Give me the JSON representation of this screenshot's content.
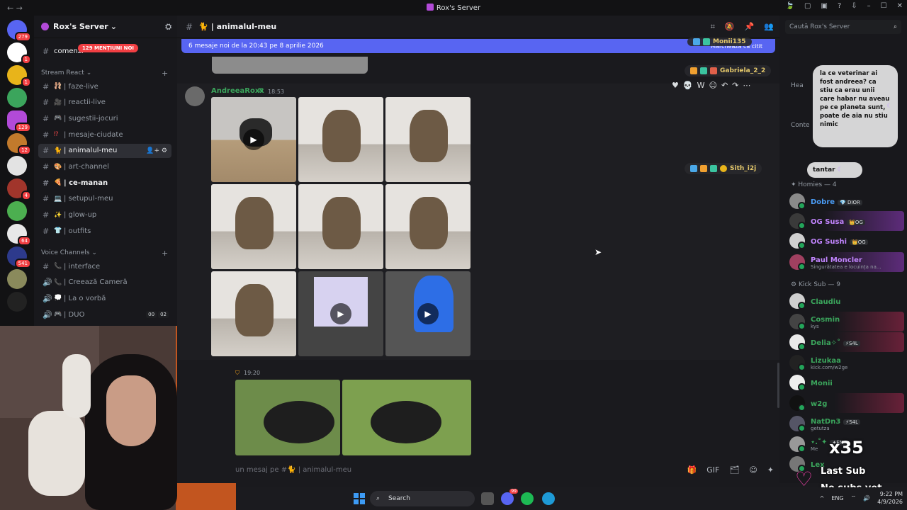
{
  "window": {
    "title": "Rox's Server",
    "nav": "← →",
    "controls": [
      "🍃",
      "▢",
      "▣",
      "?",
      "⇩",
      "–",
      "☐",
      "✕"
    ]
  },
  "servers": {
    "items": [
      {
        "name": "home",
        "color": "#5865f2",
        "badge": "279"
      },
      {
        "name": "server-w",
        "color": "#ffffff",
        "badge": "1"
      },
      {
        "name": "server-yellow",
        "color": "#e8b41a",
        "badge": "1"
      },
      {
        "name": "server-green",
        "color": "#3ba55c",
        "badge": ""
      },
      {
        "name": "server-rox",
        "color": "#b24ad8",
        "badge": "129"
      },
      {
        "name": "server-hammer",
        "color": "#c27a2c",
        "badge": "12"
      },
      {
        "name": "server-discord",
        "color": "#e3e3e3",
        "badge": ""
      },
      {
        "name": "server-red",
        "color": "#a1352b",
        "badge": "4"
      },
      {
        "name": "server-green2",
        "color": "#4caf50",
        "badge": ""
      },
      {
        "name": "server-pokemon",
        "color": "#e8e8e8",
        "badge": "64"
      },
      {
        "name": "server-star",
        "color": "#2d3a8c",
        "badge": "541"
      },
      {
        "name": "server-x",
        "color": "#8a8a5c",
        "badge": ""
      },
      {
        "name": "server-w2g",
        "color": "#222222",
        "badge": ""
      }
    ]
  },
  "server": {
    "name": "Rox's Server",
    "chevron": "⌄",
    "mentions": "129 MENȚIUNI NOI",
    "partial_channel": "comenzi"
  },
  "categories": {
    "stream_react": "Stream React",
    "voice": "Voice Channels",
    "stream_arrow": "⌄",
    "voice_arrow": "⌄"
  },
  "channels": [
    {
      "name": "| faze-live",
      "emoji": "🩰",
      "color": "#e86a7a"
    },
    {
      "name": "| reactii-live",
      "emoji": "🎥",
      "color": "#d99"
    },
    {
      "name": "| sugestii-jocuri",
      "emoji": "🎮",
      "color": "#9c7cff"
    },
    {
      "name": "| mesaje-ciudate",
      "emoji": "⁉",
      "color": "#f04747"
    },
    {
      "name": "| animalul-meu",
      "emoji": "🐈",
      "color": "#e8a05a",
      "active": true
    },
    {
      "name": "| art-channel",
      "emoji": "🎨",
      "color": "#eab"
    },
    {
      "name": "| ce-manan",
      "emoji": "🍕",
      "color": "#f0a030",
      "bold": true
    },
    {
      "name": "| setupul-meu",
      "emoji": "💻",
      "color": "#4aa8e8"
    },
    {
      "name": "| glow-up",
      "emoji": "✨",
      "color": "#f5d76e"
    },
    {
      "name": "| outfits",
      "emoji": "👕",
      "color": "#3ba55c"
    }
  ],
  "voice_channels": [
    {
      "name": "| interface",
      "emoji": "📞",
      "icon": "#"
    },
    {
      "name": "| Creează Cameră",
      "emoji": "📞",
      "icon": "🔊"
    },
    {
      "name": "| La o vorbă",
      "emoji": "💭",
      "icon": "🔊"
    },
    {
      "name": "| DUO",
      "emoji": "🎮",
      "icon": "🔊",
      "counts": [
        "00",
        "02"
      ]
    }
  ],
  "channel_header": {
    "name": "| animalul-meu",
    "emoji": "🐈",
    "hash": "#"
  },
  "new_messages": {
    "text": "6 mesaje noi de la 20:43 pe 8 aprilie 2026",
    "mark": "Marchează ca citit"
  },
  "message": {
    "author": "AndreeaRoxx",
    "time": "18:53",
    "author_icon": "⊠"
  },
  "message2": {
    "time": "19:20"
  },
  "hover_actions": [
    "♥",
    "💀",
    "W",
    "☺",
    "↶",
    "↷",
    "⋯"
  ],
  "composer": {
    "placeholder": "un mesaj pe #🐈 | animalul-meu",
    "icons": [
      "🎁",
      "GIF",
      "🗂",
      "☺",
      "✦"
    ]
  },
  "floaters": [
    {
      "name": "Gabriela_2_2"
    },
    {
      "name": "Sith_i2j"
    },
    {
      "name": "Monii135"
    }
  ],
  "search": {
    "placeholder": "Caută Rox's Server"
  },
  "chat_bubble": {
    "text": "la ce veterinar ai fost andreea? ca stiu ca erau unii care habar nu aveau pe ce planeta sunt, poate de aia nu stiu nimic",
    "small": "tantar"
  },
  "member_groups": {
    "homies": "Homies — 4",
    "kick_sub": "Kick Sub — 9",
    "content": "Conte",
    "head": "Hea"
  },
  "members": [
    {
      "name": "Dobre",
      "tag": "💎 DIOR",
      "sub": "",
      "color": "#4a9cf5"
    },
    {
      "name": "OG Susa",
      "tag": "👑OG",
      "sub": "",
      "color": "#c084fc"
    },
    {
      "name": "OG Sushi",
      "tag": "👑OG",
      "sub": "",
      "color": "#c084fc"
    },
    {
      "name": "Paul Moncler",
      "tag": "",
      "sub": "Singurătatea e locuința na...",
      "color": "#c084fc"
    },
    {
      "name": "Claudiu",
      "tag": "",
      "sub": "",
      "color": "#3ba55c"
    },
    {
      "name": "Cosmin",
      "tag": "",
      "sub": "kys",
      "color": "#3ba55c"
    },
    {
      "name": "Delia✧˚",
      "tag": "⚡S4L",
      "sub": "",
      "color": "#3ba55c"
    },
    {
      "name": "Lizukaa",
      "tag": "",
      "sub": "kick.com/w2ge",
      "color": "#3ba55c"
    },
    {
      "name": "Monii",
      "tag": "",
      "sub": "",
      "color": "#3ba55c"
    },
    {
      "name": "w2g",
      "tag": "",
      "sub": "",
      "color": "#3ba55c"
    },
    {
      "name": "NatDn3",
      "tag": "⚡S4L",
      "sub": "getutza",
      "color": "#3ba55c"
    },
    {
      "name": "⋆.˚✦",
      "tag": "✦EN-",
      "sub": "Me",
      "color": "#3ba55c"
    },
    {
      "name": "Lex",
      "tag": "",
      "sub": "",
      "color": "#3ba55c"
    }
  ],
  "overlay": {
    "sub_count": "x35",
    "last_sub": "Last Sub",
    "no_subs": "No subs yet"
  },
  "taskbar": {
    "search": "Search",
    "lang": "ENG",
    "time": "9:22 PM",
    "date": "4/9/2026",
    "tray": "^",
    "discord_badge": "99"
  }
}
